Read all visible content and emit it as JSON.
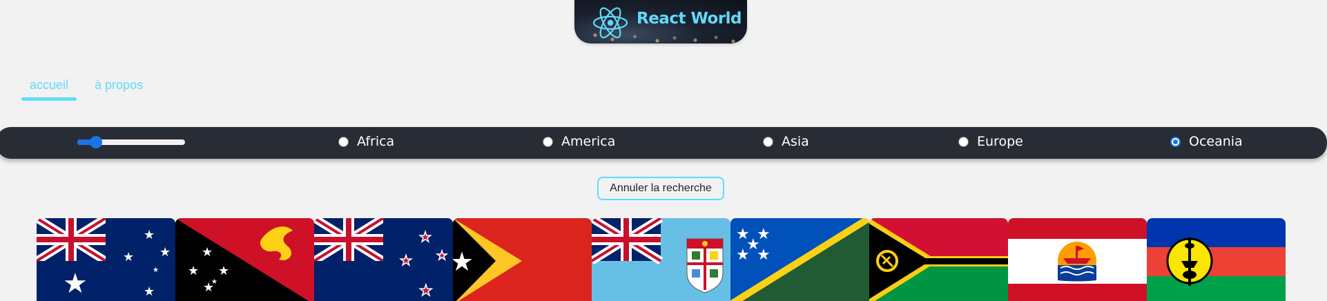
{
  "header": {
    "logo_text": "React World",
    "logo_icon": "react-atom-icon"
  },
  "nav": {
    "items": [
      {
        "label": "accueil",
        "active": true
      },
      {
        "label": "à propos",
        "active": false
      }
    ]
  },
  "filters": {
    "slider": {
      "value_fraction": 0.17
    },
    "regions": [
      {
        "label": "Africa",
        "checked": false
      },
      {
        "label": "America",
        "checked": false
      },
      {
        "label": "Asia",
        "checked": false
      },
      {
        "label": "Europe",
        "checked": false
      },
      {
        "label": "Oceania",
        "checked": true
      }
    ]
  },
  "actions": {
    "cancel_label": "Annuler la recherche"
  },
  "flags": [
    {
      "name": "australia-flag"
    },
    {
      "name": "papua-new-guinea-flag"
    },
    {
      "name": "new-zealand-flag"
    },
    {
      "name": "timor-leste-flag"
    },
    {
      "name": "fiji-flag"
    },
    {
      "name": "solomon-islands-flag"
    },
    {
      "name": "vanuatu-flag"
    },
    {
      "name": "french-polynesia-flag"
    },
    {
      "name": "new-caledonia-flag"
    }
  ],
  "colors": {
    "accent": "#61dafb",
    "bar": "#282c34",
    "background": "#f2f2f2",
    "radio_checked": "#1a73e8"
  }
}
